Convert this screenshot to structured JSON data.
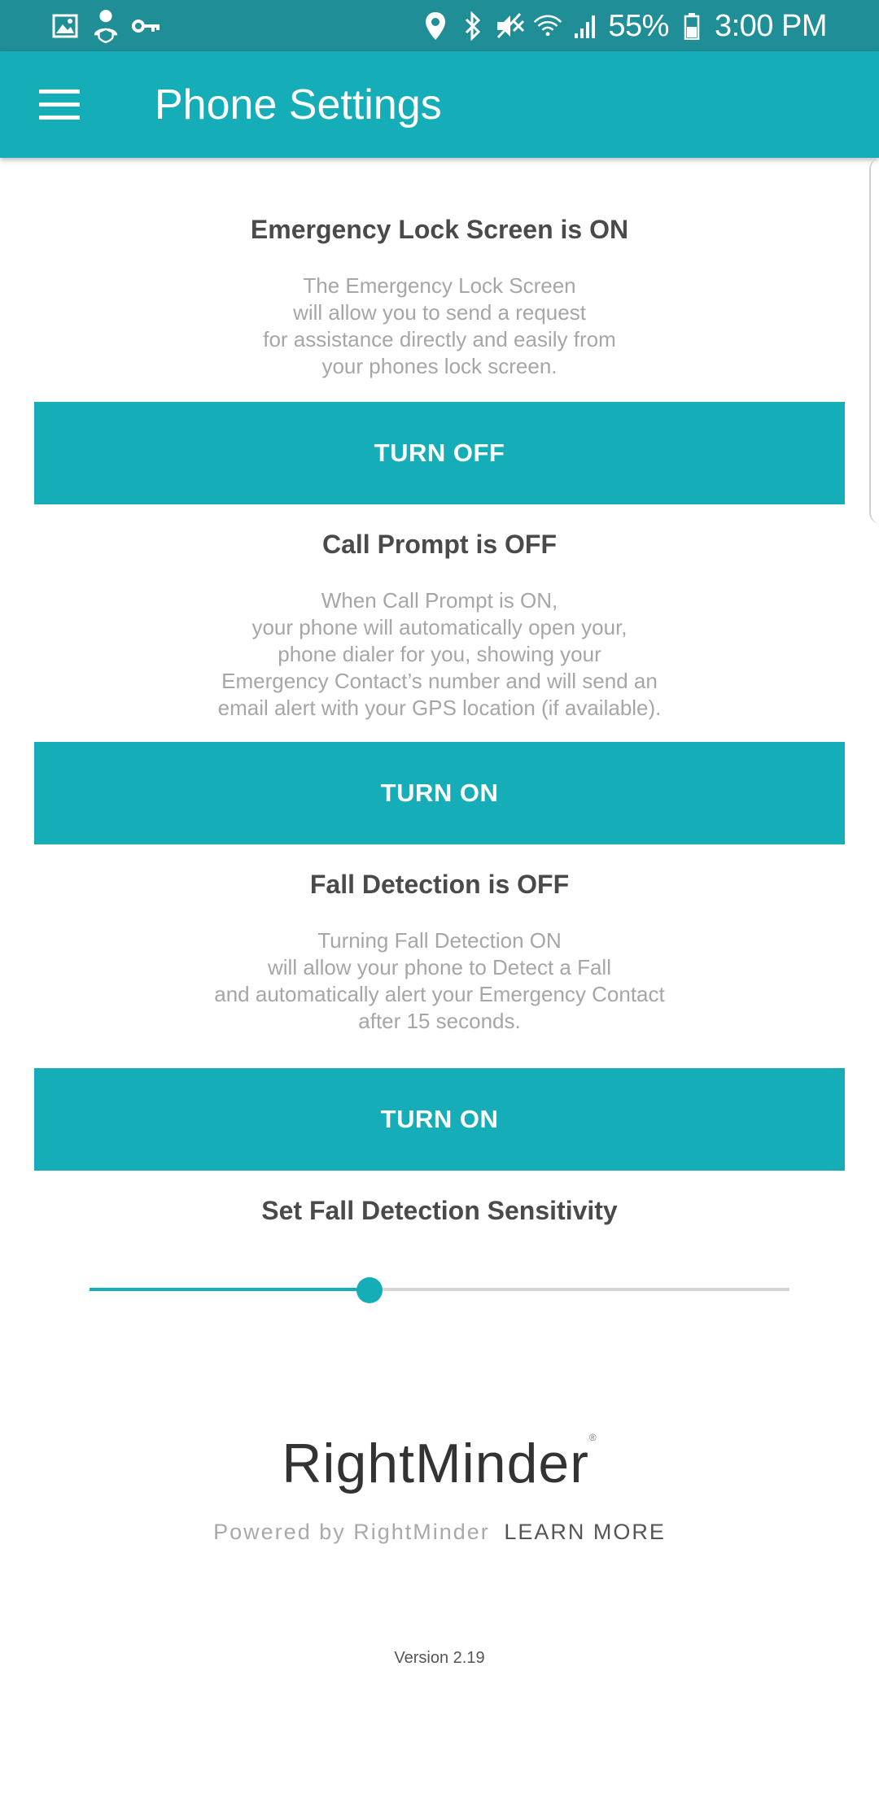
{
  "status_bar": {
    "battery": "55%",
    "time": "3:00 PM",
    "icons_left": [
      "image-icon",
      "user-shield-icon",
      "key-icon"
    ],
    "icons_right": [
      "location-icon",
      "bluetooth-icon",
      "mute-icon",
      "wifi-icon",
      "signal-icon",
      "battery-icon"
    ]
  },
  "app_bar": {
    "title": "Phone Settings",
    "menu_icon": "hamburger-menu-icon"
  },
  "colors": {
    "primary": "#14adb8",
    "status_bar": "#1f8e96",
    "title_text": "#4a4a4a",
    "desc_text": "#a6a6a6"
  },
  "sections": [
    {
      "title": "Emergency Lock Screen is ON",
      "description": [
        "The Emergency Lock Screen",
        "will allow you to send a request",
        "for assistance directly and easily from",
        "your phones lock screen."
      ],
      "button": "TURN OFF"
    },
    {
      "title": "Call Prompt is OFF",
      "description": [
        "When Call Prompt is ON,",
        "your phone will automatically open your,",
        "phone dialer for you, showing your",
        "Emergency Contact’s number and will send an",
        "email alert with your GPS location (if available)."
      ],
      "button": "TURN ON"
    },
    {
      "title": "Fall Detection is OFF",
      "description": [
        "Turning Fall Detection ON",
        "will allow your phone to Detect a Fall",
        "and automatically alert your Emergency Contact",
        "after 15 seconds."
      ],
      "button": "TURN ON"
    }
  ],
  "sensitivity": {
    "title": "Set Fall Detection Sensitivity",
    "value_fraction": 0.4
  },
  "branding": {
    "logo": "RightMinder",
    "logo_reg": "®",
    "powered_by": "Powered by RightMinder",
    "learn_more": "LEARN MORE",
    "version": "Version 2.19"
  }
}
